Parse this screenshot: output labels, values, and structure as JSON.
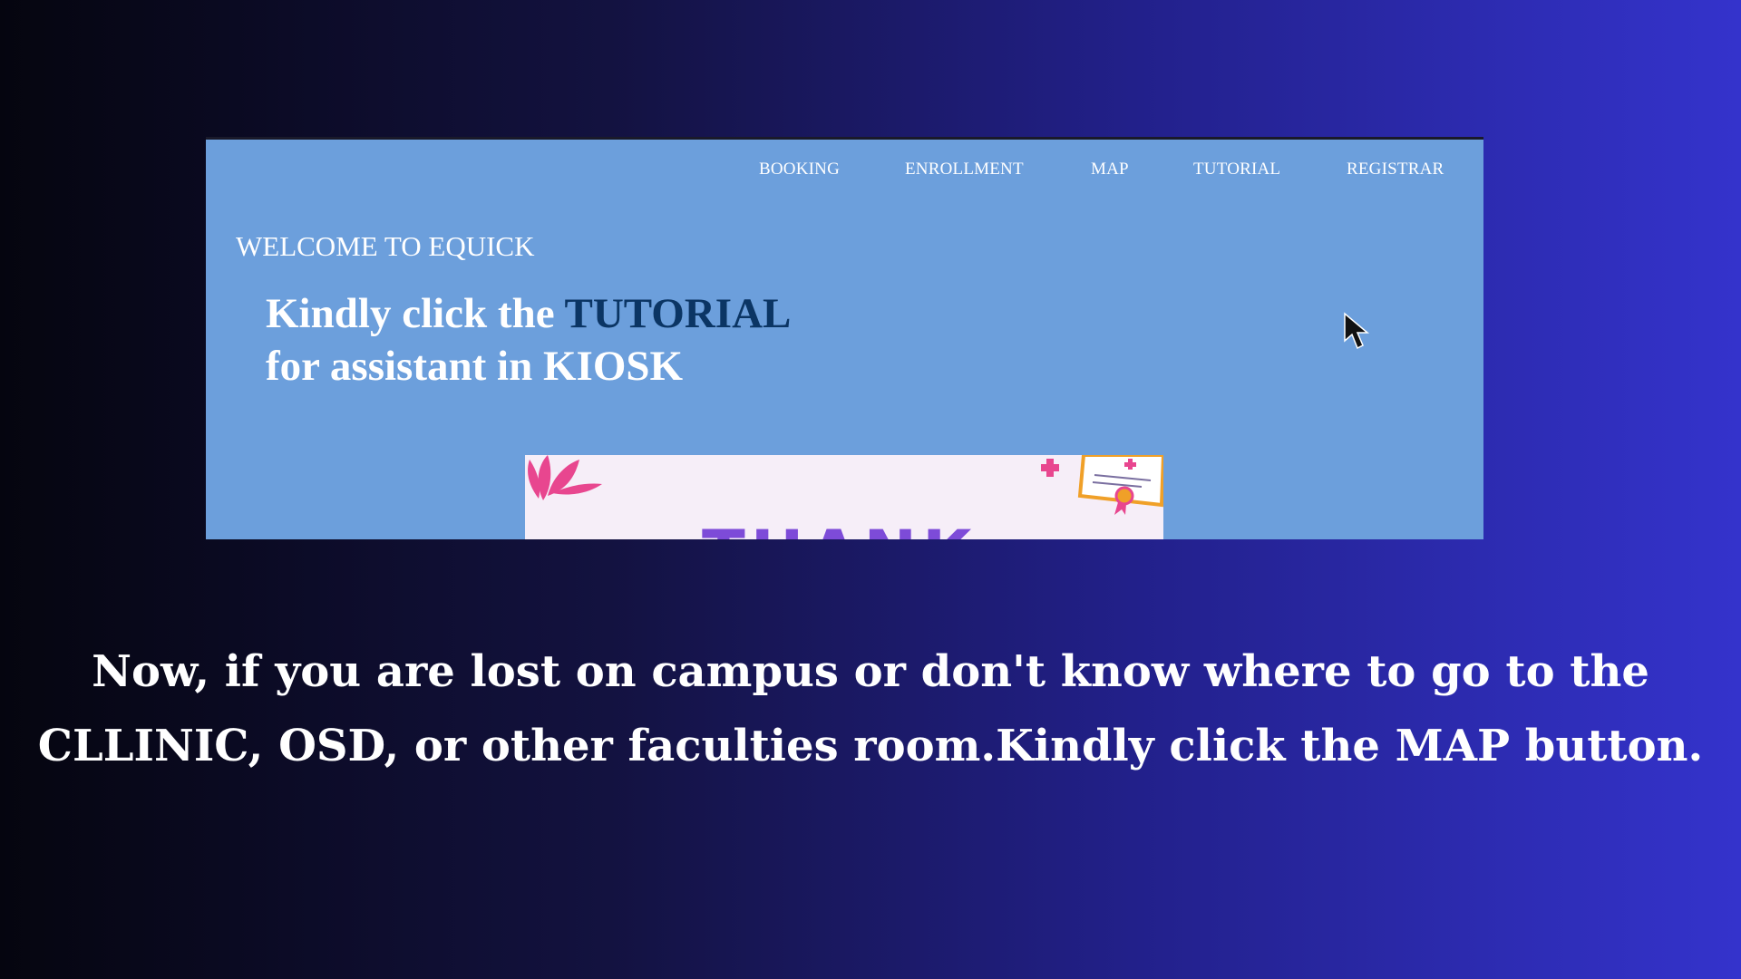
{
  "kiosk": {
    "nav": {
      "items": [
        {
          "label": "BOOKING"
        },
        {
          "label": "ENROLLMENT"
        },
        {
          "label": "MAP"
        },
        {
          "label": "TUTORIAL"
        },
        {
          "label": "REGISTRAR"
        }
      ]
    },
    "welcome": "WELCOME TO EQUICK",
    "headline": {
      "line1_prefix": "Kindly click the ",
      "line1_highlight": "TUTORIAL",
      "line2": "for assistant in KIOSK"
    },
    "banner": {
      "text": "THANK"
    },
    "colors": {
      "panel_bg": "#6c9fdc",
      "highlight": "#0b3564",
      "banner_bg": "#f6eef8",
      "banner_text": "#7d4bd8"
    }
  },
  "caption": {
    "line1": "Now, if you are lost on campus or don't know where to go to the",
    "line2": "CLLINIC, OSD, or other faculties room.Kindly click the  MAP button."
  },
  "cursor": {
    "icon": "arrow-pointer-icon"
  }
}
